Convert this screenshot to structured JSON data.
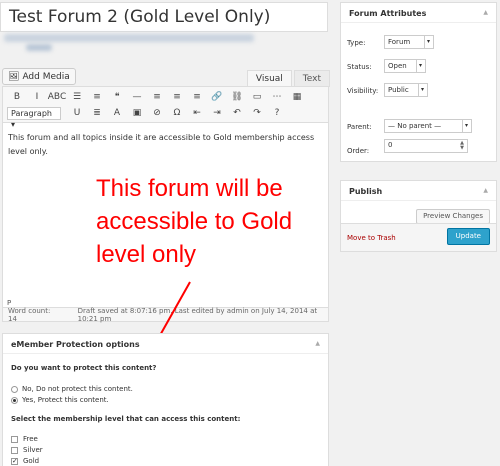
{
  "title": {
    "value": "Test Forum 2 (Gold Level Only)"
  },
  "editor": {
    "add_media_label": "Add Media",
    "tabs": [
      "Visual",
      "Text"
    ],
    "format_select": "Paragraph",
    "content": "This forum and all topics inside it are accessible to Gold membership access level only.",
    "path": "P",
    "word_count": "Word count: 14",
    "draft_status": "Draft saved at 8:07:16 pm. Last edited by admin on July 14, 2014 at 10:21 pm",
    "toolbar_row1": [
      "B",
      "I",
      "ABC",
      "☰",
      "≡",
      "❝",
      "—",
      "≡",
      "≡",
      "≡",
      "🔗",
      "⛓",
      "▭",
      "⋯",
      "▦"
    ],
    "toolbar_row2": [
      "U",
      "≣",
      "A",
      "▣",
      "⊘",
      "Ω",
      "⇤",
      "⇥",
      "↶",
      "↷",
      "?"
    ]
  },
  "annotation": "This forum will be accessible to Gold level only",
  "emember": {
    "heading": "eMember Protection options",
    "question": "Do you want to protect this content?",
    "options": [
      "No, Do not protect this content.",
      "Yes, Protect this content."
    ],
    "selected_option": 1,
    "select_label": "Select the membership level that can access this content:",
    "levels": [
      {
        "name": "Free",
        "checked": false
      },
      {
        "name": "Silver",
        "checked": false
      },
      {
        "name": "Gold",
        "checked": true
      }
    ]
  },
  "forum_attributes": {
    "heading": "Forum Attributes",
    "type_label": "Type:",
    "type_value": "Forum",
    "status_label": "Status:",
    "status_value": "Open",
    "visibility_label": "Visibility:",
    "visibility_value": "Public",
    "parent_label": "Parent:",
    "parent_value": "— No parent —",
    "order_label": "Order:",
    "order_value": "0"
  },
  "publish": {
    "heading": "Publish",
    "preview_label": "Preview Changes",
    "trash_label": "Move to Trash",
    "update_label": "Update"
  },
  "colors": {
    "annotation": "#ff0000",
    "update_button": "#2ea2cc",
    "trash_link": "#aa0000"
  }
}
